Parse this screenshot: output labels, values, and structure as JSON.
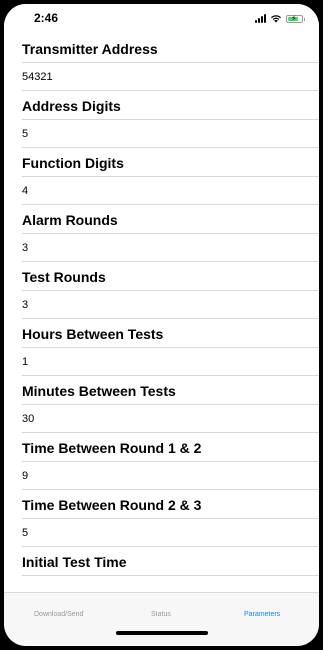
{
  "status_bar": {
    "time": "2:46",
    "icons": [
      "signal-icon",
      "wifi-icon",
      "battery-charging-icon"
    ],
    "battery_color": "#4cd964",
    "battery_level": 0.8
  },
  "parameters": [
    {
      "label": "Transmitter Address",
      "value": "54321"
    },
    {
      "label": "Address Digits",
      "value": "5"
    },
    {
      "label": "Function Digits",
      "value": "4"
    },
    {
      "label": "Alarm Rounds",
      "value": "3"
    },
    {
      "label": "Test Rounds",
      "value": "3"
    },
    {
      "label": "Hours Between Tests",
      "value": "1"
    },
    {
      "label": "Minutes Between Tests",
      "value": "30"
    },
    {
      "label": "Time Between Round 1 & 2",
      "value": "9"
    },
    {
      "label": "Time Between Round 2 & 3",
      "value": "5"
    },
    {
      "label": "Initial Test Time",
      "value": ""
    }
  ],
  "tab_bar": {
    "tabs": [
      {
        "label": "Download/Send",
        "active": false
      },
      {
        "label": "Status",
        "active": false
      },
      {
        "label": "Parameters",
        "active": true
      }
    ],
    "active_color": "#1a82fb",
    "inactive_color": "#999999"
  }
}
